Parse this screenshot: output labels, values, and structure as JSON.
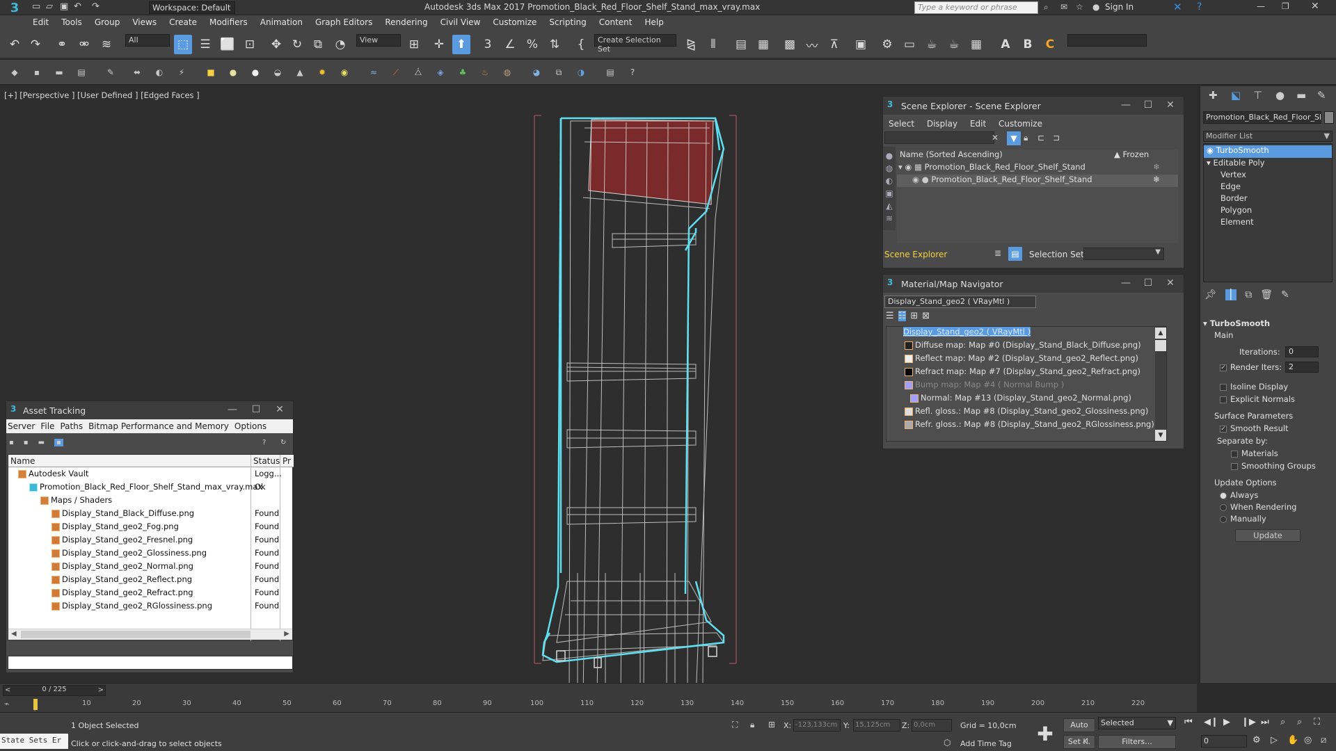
{
  "titlebar": {
    "workspace": "Workspace: Default",
    "title": "Autodesk 3ds Max 2017    Promotion_Black_Red_Floor_Shelf_Stand_max_vray.max",
    "search_placeholder": "Type a keyword or phrase",
    "signin": "Sign In"
  },
  "menu": [
    "Edit",
    "Tools",
    "Group",
    "Views",
    "Create",
    "Modifiers",
    "Animation",
    "Graph Editors",
    "Rendering",
    "Civil View",
    "Customize",
    "Scripting",
    "Content",
    "Help"
  ],
  "toolbar": {
    "filter": "All",
    "view": "View",
    "selection_set": "Create Selection Set"
  },
  "viewport": {
    "label": "[+] [Perspective ] [User Defined ] [Edged Faces ]"
  },
  "scene_explorer": {
    "title": "Scene Explorer - Scene Explorer",
    "menu": [
      "Select",
      "Display",
      "Edit",
      "Customize"
    ],
    "col_name": "Name (Sorted Ascending)",
    "col_frozen": "▲ Frozen",
    "parent": "Promotion_Black_Red_Floor_Shelf_Stand",
    "child": "Promotion_Black_Red_Floor_Shelf_Stand",
    "footer": "Scene Explorer",
    "selection_set_label": "Selection Set:"
  },
  "material_nav": {
    "title": "Material/Map Navigator",
    "material": "Display_Stand_geo2  ( VRayMtl )",
    "items": [
      "Display_Stand_geo2  ( VRayMtl )",
      "Diffuse map: Map #0 (Display_Stand_Black_Diffuse.png)",
      "Reflect map: Map #2 (Display_Stand_geo2_Reflect.png)",
      "Refract map: Map #7 (Display_Stand_geo2_Refract.png)",
      "Bump map: Map #4  ( Normal Bump )",
      "Normal: Map #13 (Display_Stand_geo2_Normal.png)",
      "Refl. gloss.: Map #8 (Display_Stand_geo2_Glossiness.png)",
      "Refr. gloss.: Map #8 (Display_Stand_geo2_RGlossiness.png)"
    ]
  },
  "asset_tracking": {
    "title": "Asset Tracking",
    "menu": [
      "Server",
      "File",
      "Paths",
      "Bitmap Performance and Memory",
      "Options"
    ],
    "col_name": "Name",
    "col_status": "Status",
    "col_pr": "Pr",
    "vault": "Autodesk Vault",
    "vault_status": "Logg...",
    "file": "Promotion_Black_Red_Floor_Shelf_Stand_max_vray.max",
    "file_status": "Ok",
    "maps": "Maps / Shaders",
    "rows": [
      {
        "n": "Display_Stand_Black_Diffuse.png",
        "s": "Found"
      },
      {
        "n": "Display_Stand_geo2_Fog.png",
        "s": "Found"
      },
      {
        "n": "Display_Stand_geo2_Fresnel.png",
        "s": "Found"
      },
      {
        "n": "Display_Stand_geo2_Glossiness.png",
        "s": "Found"
      },
      {
        "n": "Display_Stand_geo2_Normal.png",
        "s": "Found"
      },
      {
        "n": "Display_Stand_geo2_Reflect.png",
        "s": "Found"
      },
      {
        "n": "Display_Stand_geo2_Refract.png",
        "s": "Found"
      },
      {
        "n": "Display_Stand_geo2_RGlossiness.png",
        "s": "Found"
      }
    ]
  },
  "command_panel": {
    "object_name": "Promotion_Black_Red_Floor_Shelf_",
    "modifier_list": "Modifier List",
    "stack": [
      "TurboSmooth",
      "Editable Poly",
      "Vertex",
      "Edge",
      "Border",
      "Polygon",
      "Element"
    ],
    "rollout": "TurboSmooth",
    "main": "Main",
    "iterations_label": "Iterations:",
    "iterations": "0",
    "render_iters_label": "Render Iters:",
    "render_iters": "2",
    "isoline": "Isoline Display",
    "explicit": "Explicit Normals",
    "surface": "Surface Parameters",
    "smooth": "Smooth Result",
    "separate": "Separate by:",
    "materials": "Materials",
    "smoothing": "Smoothing Groups",
    "update_opts": "Update Options",
    "always": "Always",
    "when_rendering": "When Rendering",
    "manually": "Manually",
    "update_btn": "Update"
  },
  "timeline": {
    "frame": "0 / 225",
    "ticks": [
      "10",
      "20",
      "30",
      "40",
      "50",
      "60",
      "70",
      "80",
      "90",
      "100",
      "110",
      "120",
      "130",
      "140",
      "150",
      "160",
      "170",
      "180",
      "190",
      "200",
      "210",
      "220"
    ]
  },
  "status": {
    "maxscript": "State Sets  Er",
    "selected": "1 Object Selected",
    "prompt": "Click or click-and-drag to select objects",
    "x_label": "X:",
    "x": "-123,133cm",
    "y_label": "Y:",
    "y": "15,125cm",
    "z_label": "Z:",
    "z": "0,0cm",
    "grid": "Grid = 10,0cm",
    "add_time_tag": "Add Time Tag",
    "auto": "Auto",
    "set_key": "Set K.",
    "key_mode": "Selected",
    "filters": "Filters...",
    "frame_field": "0"
  },
  "colors": {
    "accent": "#5a9be0",
    "wire": "#d8d8d8",
    "selection": "#5fe0f0",
    "red": "#7a2a2a"
  }
}
